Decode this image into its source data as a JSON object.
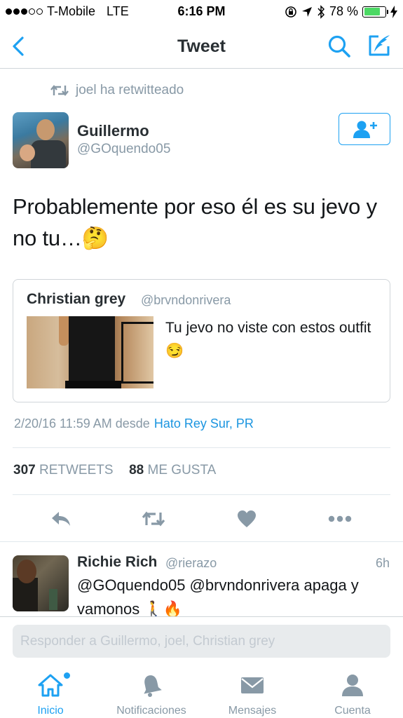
{
  "status_bar": {
    "carrier": "T-Mobile",
    "network": "LTE",
    "time": "6:16 PM",
    "battery_percent": "78 %",
    "battery_level": 0.78,
    "signal_bars": 3
  },
  "nav": {
    "title": "Tweet",
    "icons": [
      "chevron-left-icon",
      "search-icon",
      "compose-icon"
    ]
  },
  "tweet": {
    "retweet_context": "joel ha retwitteado",
    "author_name": "Guillermo",
    "author_handle": "@GOquendo05",
    "text": "Probablemente por eso él es su jevo y no tu…🤔",
    "quoted": {
      "author_name": "Christian grey",
      "author_handle": "@brvndonrivera",
      "text": "Tu jevo no viste con estos outfit 😏"
    },
    "timestamp": "2/20/16 11:59 AM desde",
    "location": "Hato Rey Sur, PR",
    "retweet_count": "307",
    "retweet_label": "RETWEETS",
    "like_count": "88",
    "like_label": "ME GUSTA"
  },
  "reply": {
    "author_name": "Richie Rich",
    "author_handle": "@rierazo",
    "time": "6h",
    "text": "@GOquendo05 @brvndonrivera apaga y vamonos 🚶🔥"
  },
  "compose": {
    "placeholder": "Responder a Guillermo, joel, Christian grey"
  },
  "tabs": [
    {
      "label": "Inicio",
      "icon": "home-icon",
      "active": true,
      "has_badge": true
    },
    {
      "label": "Notificaciones",
      "icon": "bell-icon",
      "active": false
    },
    {
      "label": "Mensajes",
      "icon": "envelope-icon",
      "active": false
    },
    {
      "label": "Cuenta",
      "icon": "person-icon",
      "active": false
    }
  ],
  "colors": {
    "accent": "#1da1f2",
    "muted": "#8899a6",
    "text": "#14171a",
    "link": "#1b95e0",
    "battery": "#4cd964"
  }
}
